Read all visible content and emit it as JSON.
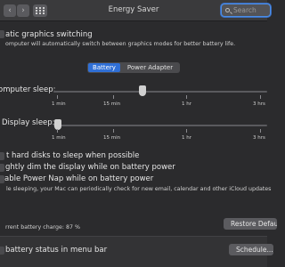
{
  "window": {
    "title": "Energy Saver",
    "back_glyph": "‹",
    "forward_glyph": "›",
    "search_placeholder": "Search"
  },
  "graphics_switching": {
    "title": "atic graphics switching",
    "desc": "omputer will automatically switch between graphics modes for better battery life."
  },
  "tabs": {
    "battery": "Battery",
    "power_adapter": "Power Adapter",
    "selected": "Battery"
  },
  "computer_sleep": {
    "label": "omputer sleep:",
    "value_fraction": 0.42
  },
  "display_sleep": {
    "label": "Display sleep:",
    "value_fraction": 0.0
  },
  "ticks": [
    "1 min",
    "15 min",
    "1 hr",
    "3 hrs"
  ],
  "options": {
    "hard_disks": "t hard disks to sleep when possible",
    "dim_display": "ghtly dim the display while on battery power",
    "power_nap": "able Power Nap while on battery power",
    "power_nap_desc": "le sleeping, your Mac can periodically check for new email, calendar and other iCloud updates"
  },
  "battery_charge": "rrent battery charge: 87 %",
  "restore_button": "Restore Defaults",
  "footer": {
    "show_status": "battery status in menu bar",
    "schedule_button": "Schedule..."
  },
  "colors": {
    "accent": "#2f6fd6",
    "background": "#2b2b2d"
  }
}
